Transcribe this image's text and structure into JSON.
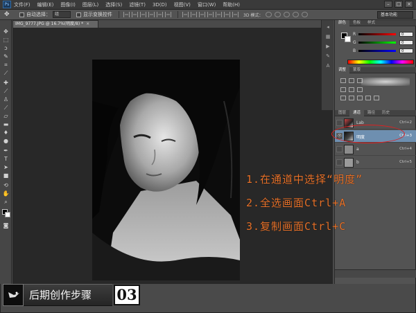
{
  "app": {
    "logo_text": "Ps",
    "menu": [
      "文件(F)",
      "编辑(E)",
      "图像(I)",
      "图层(L)",
      "选择(S)",
      "滤镜(T)",
      "3D(D)",
      "视图(V)",
      "窗口(W)",
      "帮助(H)"
    ],
    "window_buttons": [
      "–",
      "□",
      "×"
    ]
  },
  "options_bar": {
    "move_tool_icon": "move-tool-icon",
    "auto_select_label": "自动选择：",
    "auto_select_value": "组",
    "show_transform_label": "显示变换控件",
    "mode_3d_label": "3D 模式：",
    "workspace": "基本功能"
  },
  "document": {
    "tab_title": "IMG_9777.JPG @ 16.7%(明度/8) *",
    "close_glyph": "×"
  },
  "panels": {
    "color_tabs": [
      "颜色",
      "色板",
      "样式"
    ],
    "rgb_channels": [
      {
        "label": "R",
        "value": "0"
      },
      {
        "label": "G",
        "value": "0"
      },
      {
        "label": "B",
        "value": "0"
      }
    ],
    "adjust_tabs": [
      "调整",
      "蒙版"
    ],
    "channel_tabs": [
      "图层",
      "通道",
      "路径",
      "历史"
    ],
    "channels": [
      {
        "name": "Lab",
        "shortcut": "Ctrl+2",
        "selected": false
      },
      {
        "name": "明度",
        "shortcut": "Ctrl+3",
        "selected": true
      },
      {
        "name": "a",
        "shortcut": "Ctrl+4",
        "selected": false
      },
      {
        "name": "b",
        "shortcut": "Ctrl+5",
        "selected": false
      }
    ]
  },
  "instructions": [
    "1.在通道中选择“明度”",
    "2.全选画面Ctrl+A",
    "3.复制画面Ctrl+C"
  ],
  "step_banner": {
    "title": "后期创作步骤",
    "number": "03"
  },
  "colors": {
    "instruction_text": "#e8722a",
    "selected_channel": "#6e8fb0",
    "highlight_ellipse": "#e02020"
  }
}
